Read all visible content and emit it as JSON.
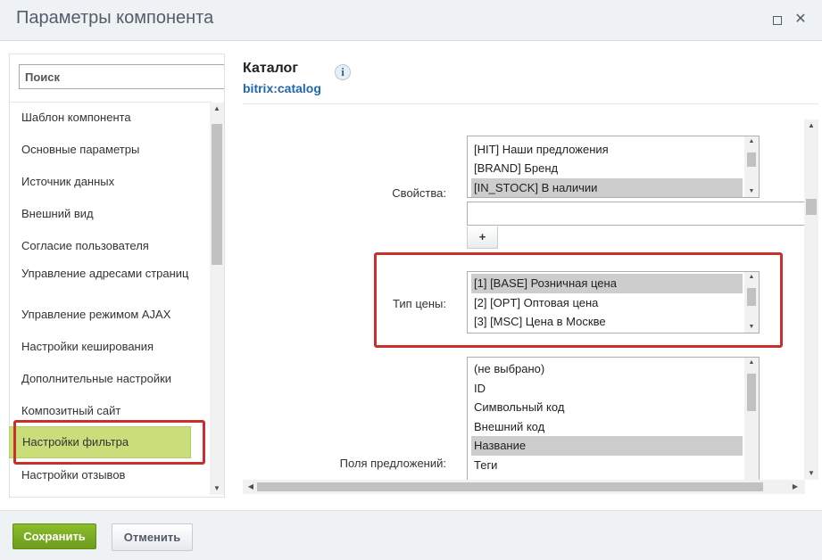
{
  "window": {
    "title": "Параметры компонента",
    "minimize_icon": "minimize-icon",
    "close_glyph": "✕"
  },
  "sidebar": {
    "search_placeholder": "Поиск",
    "items": [
      {
        "label": "Шаблон компонента",
        "active": false
      },
      {
        "label": "Основные параметры",
        "active": false
      },
      {
        "label": "Источник данных",
        "active": false
      },
      {
        "label": "Внешний вид",
        "active": false
      },
      {
        "label": "Согласие пользователя",
        "active": false
      },
      {
        "label": "Управление адресами страниц",
        "active": false
      },
      {
        "label": "Управление режимом AJAX",
        "active": false
      },
      {
        "label": "Настройки кеширования",
        "active": false
      },
      {
        "label": "Дополнительные настройки",
        "active": false
      },
      {
        "label": "Композитный сайт",
        "active": false
      },
      {
        "label": "Настройки фильтра",
        "active": true
      },
      {
        "label": "Настройки отзывов",
        "active": false
      }
    ]
  },
  "component": {
    "title": "Каталог",
    "code": "bitrix:catalog",
    "info_glyph": "i"
  },
  "params": {
    "properties": {
      "label": "Свойства:",
      "options": [
        "[HIT] Наши предложения",
        "[BRAND] Бренд",
        "[IN_STOCK] В наличии"
      ],
      "selected_index": 2,
      "text_value": "",
      "add_label": "+"
    },
    "price_type": {
      "label": "Тип цены:",
      "options": [
        "[1] [BASE] Розничная цена",
        "[2] [OPT] Оптовая цена",
        "[3] [MSC] Цена в Москве"
      ],
      "selected_index": 0
    },
    "offer_fields": {
      "label": "Поля предложений:",
      "options": [
        "(не выбрано)",
        "ID",
        "Символьный код",
        "Внешний код",
        "Название",
        "Теги"
      ],
      "selected_index": 4
    }
  },
  "colors": {
    "highlight": "#c8302c",
    "active_item": "#c9de7a",
    "save_button": "#7aad24",
    "link_blue": "#2067b0"
  },
  "footer": {
    "save_label": "Сохранить",
    "cancel_label": "Отменить"
  }
}
